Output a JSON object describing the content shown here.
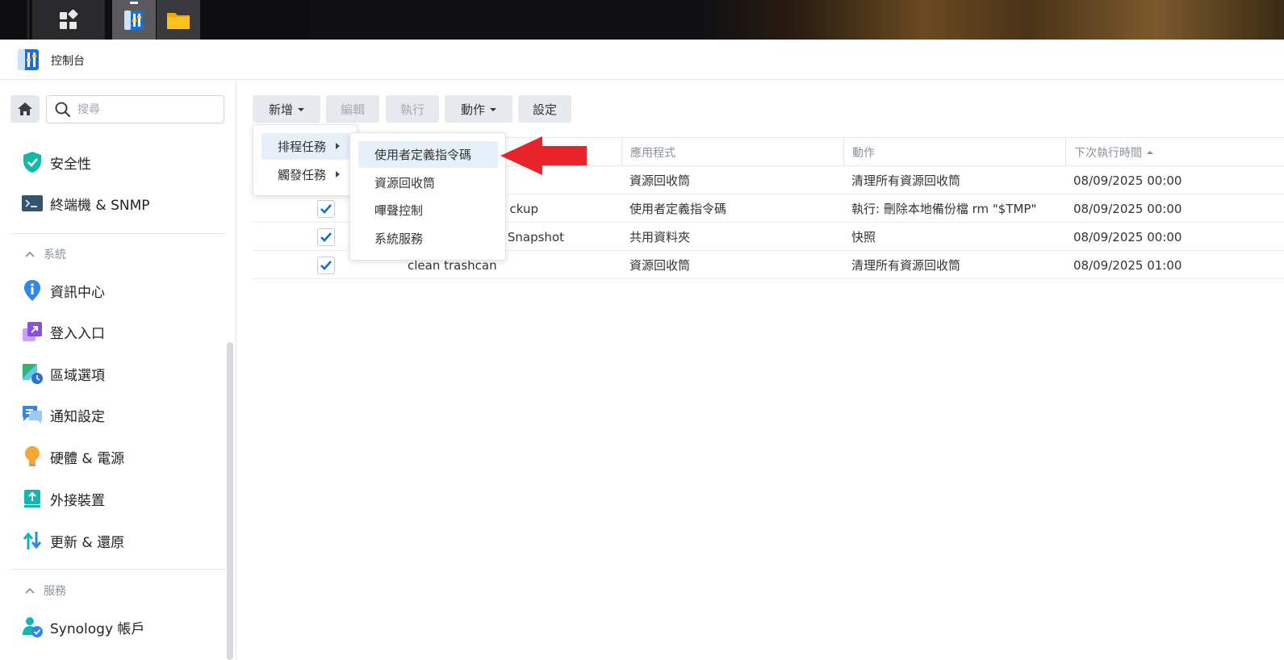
{
  "window": {
    "title": "控制台"
  },
  "search": {
    "placeholder": "搜尋"
  },
  "sidebar": {
    "items_top": [
      {
        "label": "安全性",
        "icon": "shield-icon"
      },
      {
        "label": "終端機 & SNMP",
        "icon": "terminal-icon"
      }
    ],
    "section_system": "系統",
    "items_system": [
      {
        "label": "資訊中心",
        "icon": "info-icon"
      },
      {
        "label": "登入入口",
        "icon": "login-portal-icon"
      },
      {
        "label": "區域選項",
        "icon": "regional-options-icon"
      },
      {
        "label": "通知設定",
        "icon": "notification-icon"
      },
      {
        "label": "硬體 & 電源",
        "icon": "bulb-icon"
      },
      {
        "label": "外接裝置",
        "icon": "external-device-icon"
      },
      {
        "label": "更新 & 還原",
        "icon": "update-restore-icon"
      }
    ],
    "section_services": "服務",
    "items_services": [
      {
        "label": "Synology 帳戶",
        "icon": "synology-account-icon"
      }
    ]
  },
  "toolbar": {
    "create": "新增",
    "edit": "編輯",
    "run": "執行",
    "action": "動作",
    "settings": "設定"
  },
  "create_menu": {
    "scheduled": "排程任務",
    "triggered": "觸發任務"
  },
  "submenu": {
    "items": [
      "使用者定義指令碼",
      "資源回收筒",
      "嗶聲控制",
      "系統服務"
    ]
  },
  "table": {
    "headers": {
      "app": "應用程式",
      "action": "動作",
      "next_run": "下次執行時間"
    },
    "rows": [
      {
        "checked": true,
        "name": "",
        "app": "資源回收筒",
        "action": "清理所有資源回收筒",
        "next_run": "08/09/2025 00:00"
      },
      {
        "checked": true,
        "name": "ckup",
        "app": "使用者定義指令碼",
        "action": "執行: 刪除本地備份檔 rm \"$TMP\"",
        "next_run": "08/09/2025 00:00"
      },
      {
        "checked": true,
        "name": "Snapshot",
        "app": "共用資料夾",
        "action": "快照",
        "next_run": "08/09/2025 00:00"
      },
      {
        "checked": true,
        "name": "clean trashcan",
        "app": "資源回收筒",
        "action": "清理所有資源回收筒",
        "next_run": "08/09/2025 01:00"
      }
    ]
  },
  "colors": {
    "accent": "#0a6ed1",
    "highlight": "#e6f0fb",
    "annotation_arrow": "#e8232a"
  }
}
